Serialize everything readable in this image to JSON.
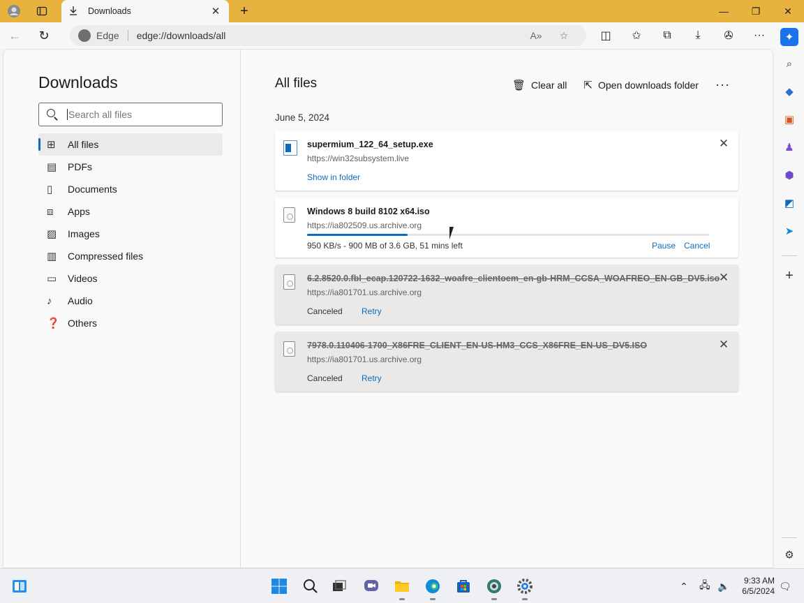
{
  "browser": {
    "tab_title": "Downloads",
    "address_label": "Edge",
    "url": "edge://downloads/all"
  },
  "sidebar": {
    "title": "Downloads",
    "search_placeholder": "Search all files",
    "items": [
      {
        "label": "All files",
        "icon": "grid-icon",
        "active": true
      },
      {
        "label": "PDFs",
        "icon": "pdf-icon"
      },
      {
        "label": "Documents",
        "icon": "document-icon"
      },
      {
        "label": "Apps",
        "icon": "apps-icon"
      },
      {
        "label": "Images",
        "icon": "image-icon"
      },
      {
        "label": "Compressed files",
        "icon": "archive-icon"
      },
      {
        "label": "Videos",
        "icon": "video-icon"
      },
      {
        "label": "Audio",
        "icon": "audio-icon"
      },
      {
        "label": "Others",
        "icon": "other-icon"
      }
    ]
  },
  "main": {
    "title": "All files",
    "clear_all": "Clear all",
    "open_folder": "Open downloads folder",
    "date_group": "June 5, 2024",
    "downloads": [
      {
        "filename": "supermium_122_64_setup.exe",
        "source": "https://win32subsystem.live",
        "action": "Show in folder",
        "state": "completed"
      },
      {
        "filename": "Windows 8 build 8102 x64.iso",
        "source": "https://ia802509.us.archive.org",
        "status": "950 KB/s - 900 MB of 3.6 GB, 51 mins left",
        "progress": 0.25,
        "pause": "Pause",
        "cancel": "Cancel",
        "state": "downloading"
      },
      {
        "filename": "6.2.8520.0.fbl_ecap.120722-1632_woafre_clientoem_en-gb-HRM_CCSA_WOAFREO_EN-GB_DV5.iso",
        "source": "https://ia801701.us.archive.org",
        "status": "Canceled",
        "action": "Retry",
        "state": "canceled"
      },
      {
        "filename": "7978.0.110406-1700_X86FRE_CLIENT_EN-US-HM3_CCS_X86FRE_EN-US_DV5.ISO",
        "source": "https://ia801701.us.archive.org",
        "status": "Canceled",
        "action": "Retry",
        "state": "canceled"
      }
    ]
  },
  "taskbar": {
    "time": "9:33 AM",
    "date": "6/5/2024"
  },
  "colors": {
    "titlebar": "#e8b23e",
    "accent": "#0f6cbd"
  }
}
